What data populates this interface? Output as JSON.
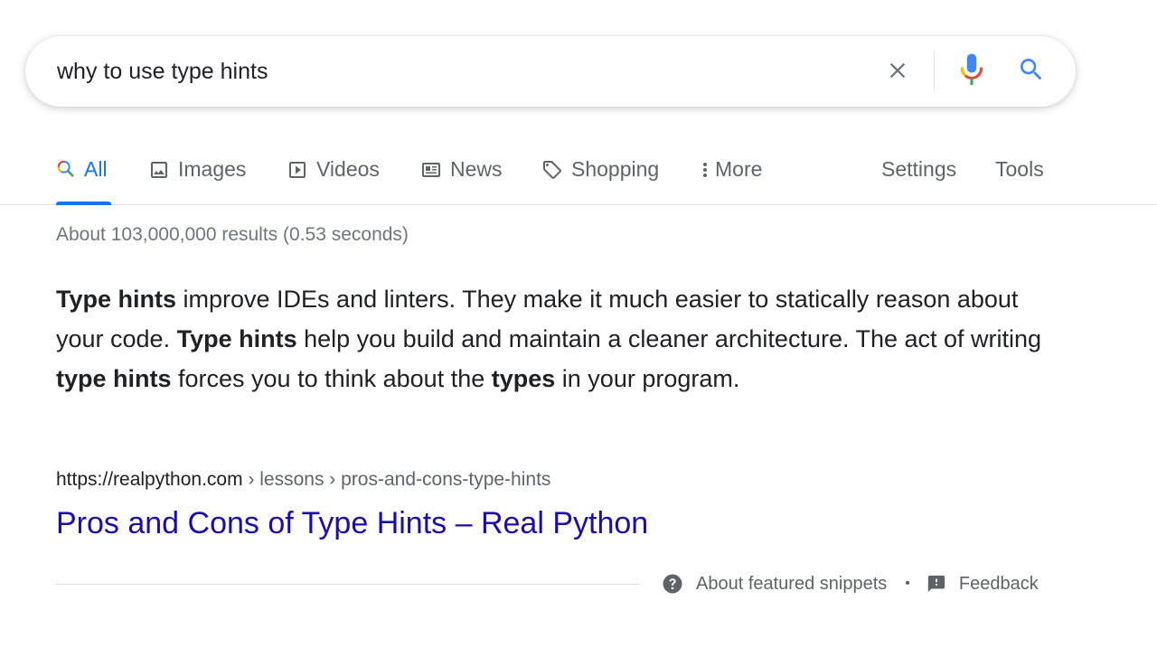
{
  "search": {
    "query": "why to use type hints",
    "icons": {
      "clear": "close-icon",
      "voice": "mic-icon",
      "search": "search-icon"
    }
  },
  "tabs": [
    {
      "label": "All",
      "icon": "search-multicolor-icon",
      "active": true
    },
    {
      "label": "Images",
      "icon": "image-icon",
      "active": false
    },
    {
      "label": "Videos",
      "icon": "play-icon",
      "active": false
    },
    {
      "label": "News",
      "icon": "newspaper-icon",
      "active": false
    },
    {
      "label": "Shopping",
      "icon": "tag-icon",
      "active": false
    },
    {
      "label": "More",
      "icon": "more-vert-icon",
      "active": false
    }
  ],
  "tools": {
    "settings_label": "Settings",
    "tools_label": "Tools"
  },
  "result_stats": "About 103,000,000 results (0.53 seconds)",
  "featured_snippet": {
    "segments": [
      {
        "text": "Type hints",
        "bold": true
      },
      {
        "text": " improve IDEs and linters. They make it much easier to statically reason about your code. ",
        "bold": false
      },
      {
        "text": "Type hints",
        "bold": true
      },
      {
        "text": " help you build and maintain a cleaner architecture. The act of writing ",
        "bold": false
      },
      {
        "text": "type hints",
        "bold": true
      },
      {
        "text": " forces you to think about the ",
        "bold": false
      },
      {
        "text": "types",
        "bold": true
      },
      {
        "text": " in your program.",
        "bold": false
      }
    ],
    "cite": {
      "domain": "https://realpython.com",
      "path": " › lessons › pros-and-cons-type-hints"
    },
    "title": "Pros and Cons of Type Hints – Real Python"
  },
  "footer": {
    "about_label": "About featured snippets",
    "separator": "•",
    "feedback_label": "Feedback"
  },
  "colors": {
    "accent": "#1a73e8",
    "link": "#1a0dab",
    "muted": "#5f6368",
    "stats": "#70757a"
  }
}
